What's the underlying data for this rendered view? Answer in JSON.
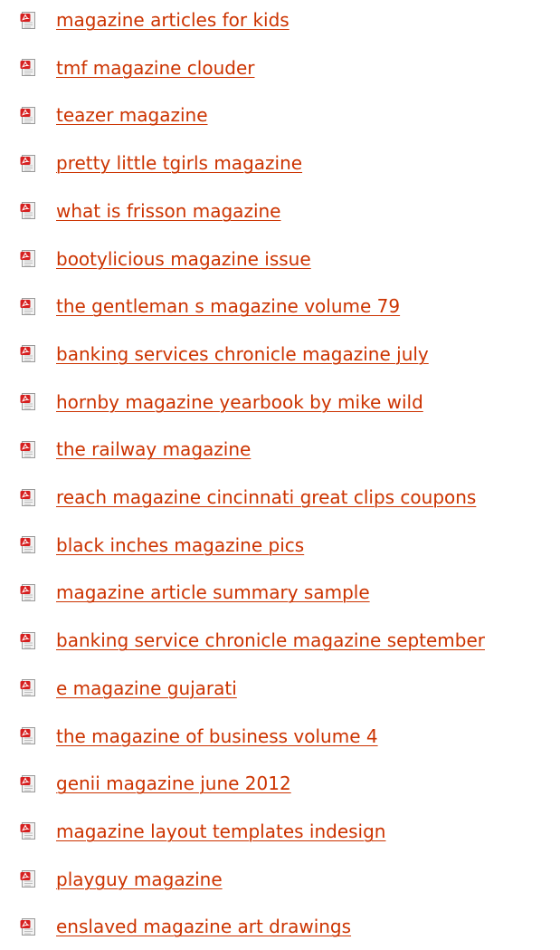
{
  "file_list": {
    "items": [
      {
        "label": "magazine articles for kids",
        "icon": "pdf-file-icon"
      },
      {
        "label": "tmf magazine clouder",
        "icon": "pdf-file-icon"
      },
      {
        "label": "teazer magazine",
        "icon": "pdf-file-icon"
      },
      {
        "label": "pretty little tgirls magazine",
        "icon": "pdf-file-icon"
      },
      {
        "label": "what is frisson magazine",
        "icon": "pdf-file-icon"
      },
      {
        "label": "bootylicious magazine issue",
        "icon": "pdf-file-icon"
      },
      {
        "label": "the gentleman s magazine volume 79",
        "icon": "pdf-file-icon"
      },
      {
        "label": "banking services chronicle magazine july",
        "icon": "pdf-file-icon"
      },
      {
        "label": "hornby magazine yearbook by mike wild",
        "icon": "pdf-file-icon"
      },
      {
        "label": "the railway magazine",
        "icon": "pdf-file-icon"
      },
      {
        "label": "reach magazine cincinnati great clips coupons",
        "icon": "pdf-file-icon"
      },
      {
        "label": "black inches magazine pics",
        "icon": "pdf-file-icon"
      },
      {
        "label": "magazine article summary sample",
        "icon": "pdf-file-icon"
      },
      {
        "label": "banking service chronicle magazine september",
        "icon": "pdf-file-icon"
      },
      {
        "label": "e magazine gujarati",
        "icon": "pdf-file-icon"
      },
      {
        "label": "the magazine of business volume 4",
        "icon": "pdf-file-icon"
      },
      {
        "label": "genii magazine june 2012",
        "icon": "pdf-file-icon"
      },
      {
        "label": "magazine layout templates indesign",
        "icon": "pdf-file-icon"
      },
      {
        "label": "playguy magazine",
        "icon": "pdf-file-icon"
      },
      {
        "label": "enslaved magazine art drawings",
        "icon": "pdf-file-icon"
      }
    ]
  },
  "colors": {
    "link": "#cc3300",
    "icon_red": "#d62020",
    "icon_page": "#f2f2f2",
    "icon_border": "#9a9a9a",
    "background": "#ffffff"
  }
}
